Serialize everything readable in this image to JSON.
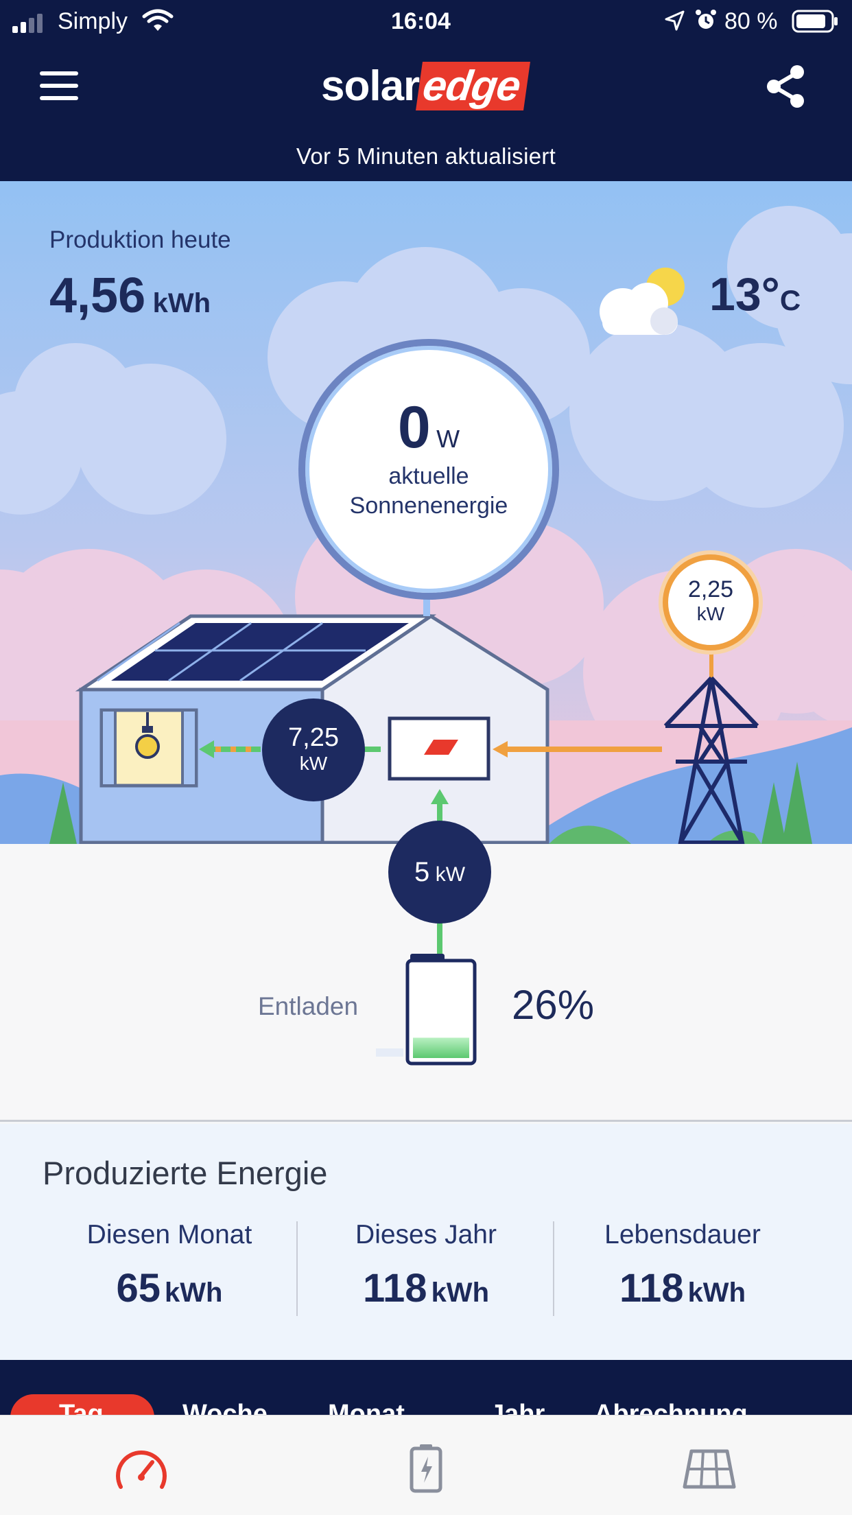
{
  "status_bar": {
    "carrier": "Simply",
    "time": "16:04",
    "battery_percent": "80 %"
  },
  "header": {
    "logo_part1": "solar",
    "logo_part2": "edge",
    "updated_text": "Vor 5 Minuten aktualisiert"
  },
  "production_today": {
    "label": "Produktion heute",
    "value": "4,56",
    "unit": "kWh"
  },
  "weather": {
    "icon": "partly-cloudy-icon",
    "temperature": "13°",
    "unit": "C"
  },
  "solar_now": {
    "value": "0",
    "unit": "W",
    "label_line1": "aktuelle",
    "label_line2": "Sonnenenergie"
  },
  "grid_power": {
    "value": "2,25",
    "unit": "kW"
  },
  "consumption": {
    "value": "7,25",
    "unit": "kW"
  },
  "battery_flow": {
    "value": "5",
    "unit": "kW"
  },
  "battery": {
    "status": "Entladen",
    "percent": "26%",
    "level": 0.26
  },
  "produced_energy": {
    "title": "Produzierte Energie",
    "stats": [
      {
        "label": "Diesen Monat",
        "value": "65",
        "unit": "kWh"
      },
      {
        "label": "Dieses Jahr",
        "value": "118",
        "unit": "kWh"
      },
      {
        "label": "Lebensdauer",
        "value": "118",
        "unit": "kWh"
      }
    ]
  },
  "period_tabs": [
    "Tag",
    "Woche",
    "Monat",
    "Jahr",
    "Abrechnung"
  ],
  "bottom_nav": {
    "items": [
      "dashboard-gauge-icon",
      "battery-icon",
      "solar-panel-icon"
    ]
  },
  "colors": {
    "navy": "#0d1945",
    "accent_red": "#e8392c",
    "flow_green": "#5cc870",
    "flow_orange": "#f0a040",
    "sky_blue": "#94c1f2"
  }
}
